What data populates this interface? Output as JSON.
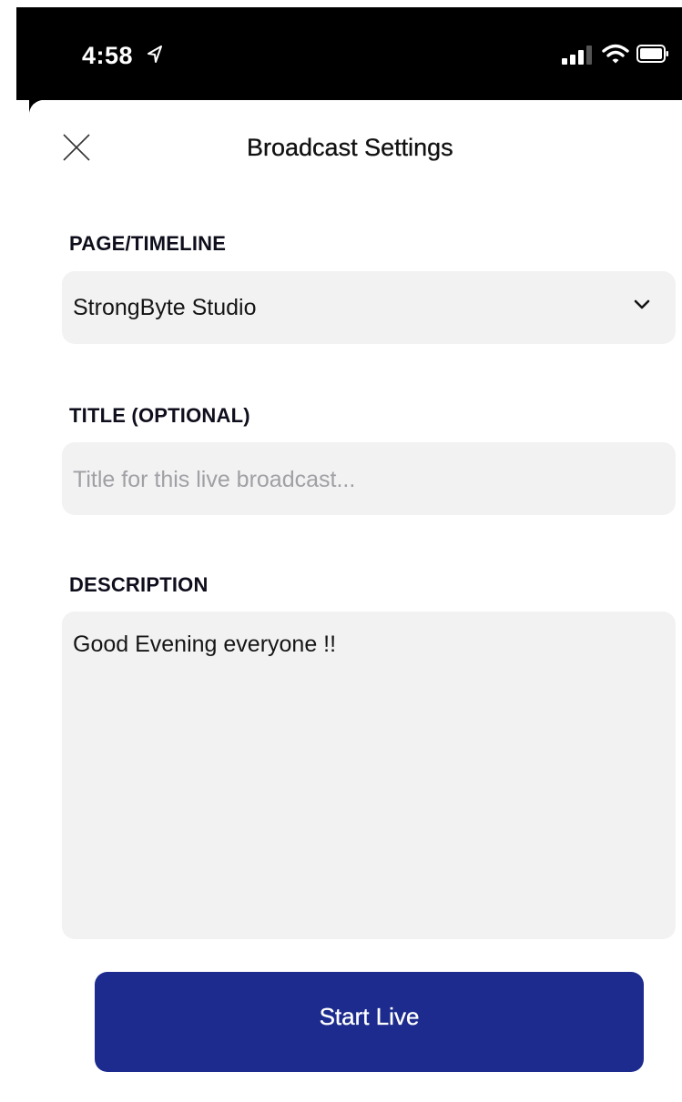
{
  "status_bar": {
    "time": "4:58"
  },
  "header": {
    "title": "Broadcast Settings"
  },
  "page_timeline": {
    "label": "PAGE/TIMELINE",
    "selected": "StrongByte Studio"
  },
  "title_field": {
    "label": "TITLE (OPTIONAL)",
    "placeholder": "Title for this live broadcast..."
  },
  "description": {
    "label": "DESCRIPTION",
    "value": "Good Evening everyone !!"
  },
  "actions": {
    "start_label": "Start Live"
  },
  "colors": {
    "status_bar_bg": "#000000",
    "field_bg": "#f2f2f3",
    "button_bg": "#1c2b8d",
    "placeholder_text": "#a0a0a5"
  },
  "icons": {
    "location": "location-arrow-icon",
    "signal": "cellular-signal-icon",
    "wifi": "wifi-icon",
    "battery": "battery-icon",
    "close": "close-icon",
    "chevron": "chevron-down-icon"
  }
}
